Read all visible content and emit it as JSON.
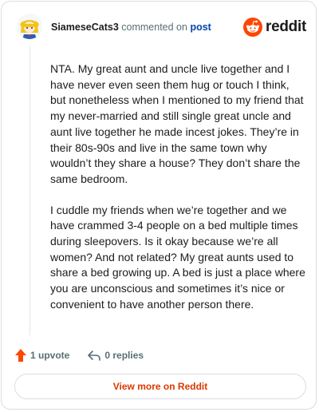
{
  "header": {
    "username": "SiameseCats3",
    "action_text": "commented on",
    "post_link": "post",
    "brand_name": "reddit"
  },
  "comment": {
    "paragraphs": [
      "NTA. My great aunt and uncle live together and I have never even seen them hug or touch I think, but nonetheless when I mentioned to my friend that my never-married and still single great uncle and aunt live together he made incest jokes. They’re in their 80s-90s and live in the same town why wouldn’t they share a house? They don’t share the same bedroom.",
      "I cuddle my friends when we’re together and we have crammed 3-4 people on a bed multiple times during sleepovers. Is it okay because we’re all women? And not related? My great aunts used to share a bed growing up. A bed is just a place where you are unconscious and sometimes it’s nice or convenient to have another person there."
    ]
  },
  "actions": {
    "upvotes": "1 upvote",
    "replies": "0 replies"
  },
  "footer": {
    "view_more": "View more on Reddit"
  },
  "colors": {
    "upvote_orange": "#ff4500",
    "link_blue": "#0045ac",
    "cta_orange": "#d93900"
  },
  "icons": {
    "avatar": "avatar-icon",
    "brand": "reddit-logo-icon",
    "upvote": "upvote-arrow-icon",
    "reply": "reply-arrow-icon"
  }
}
